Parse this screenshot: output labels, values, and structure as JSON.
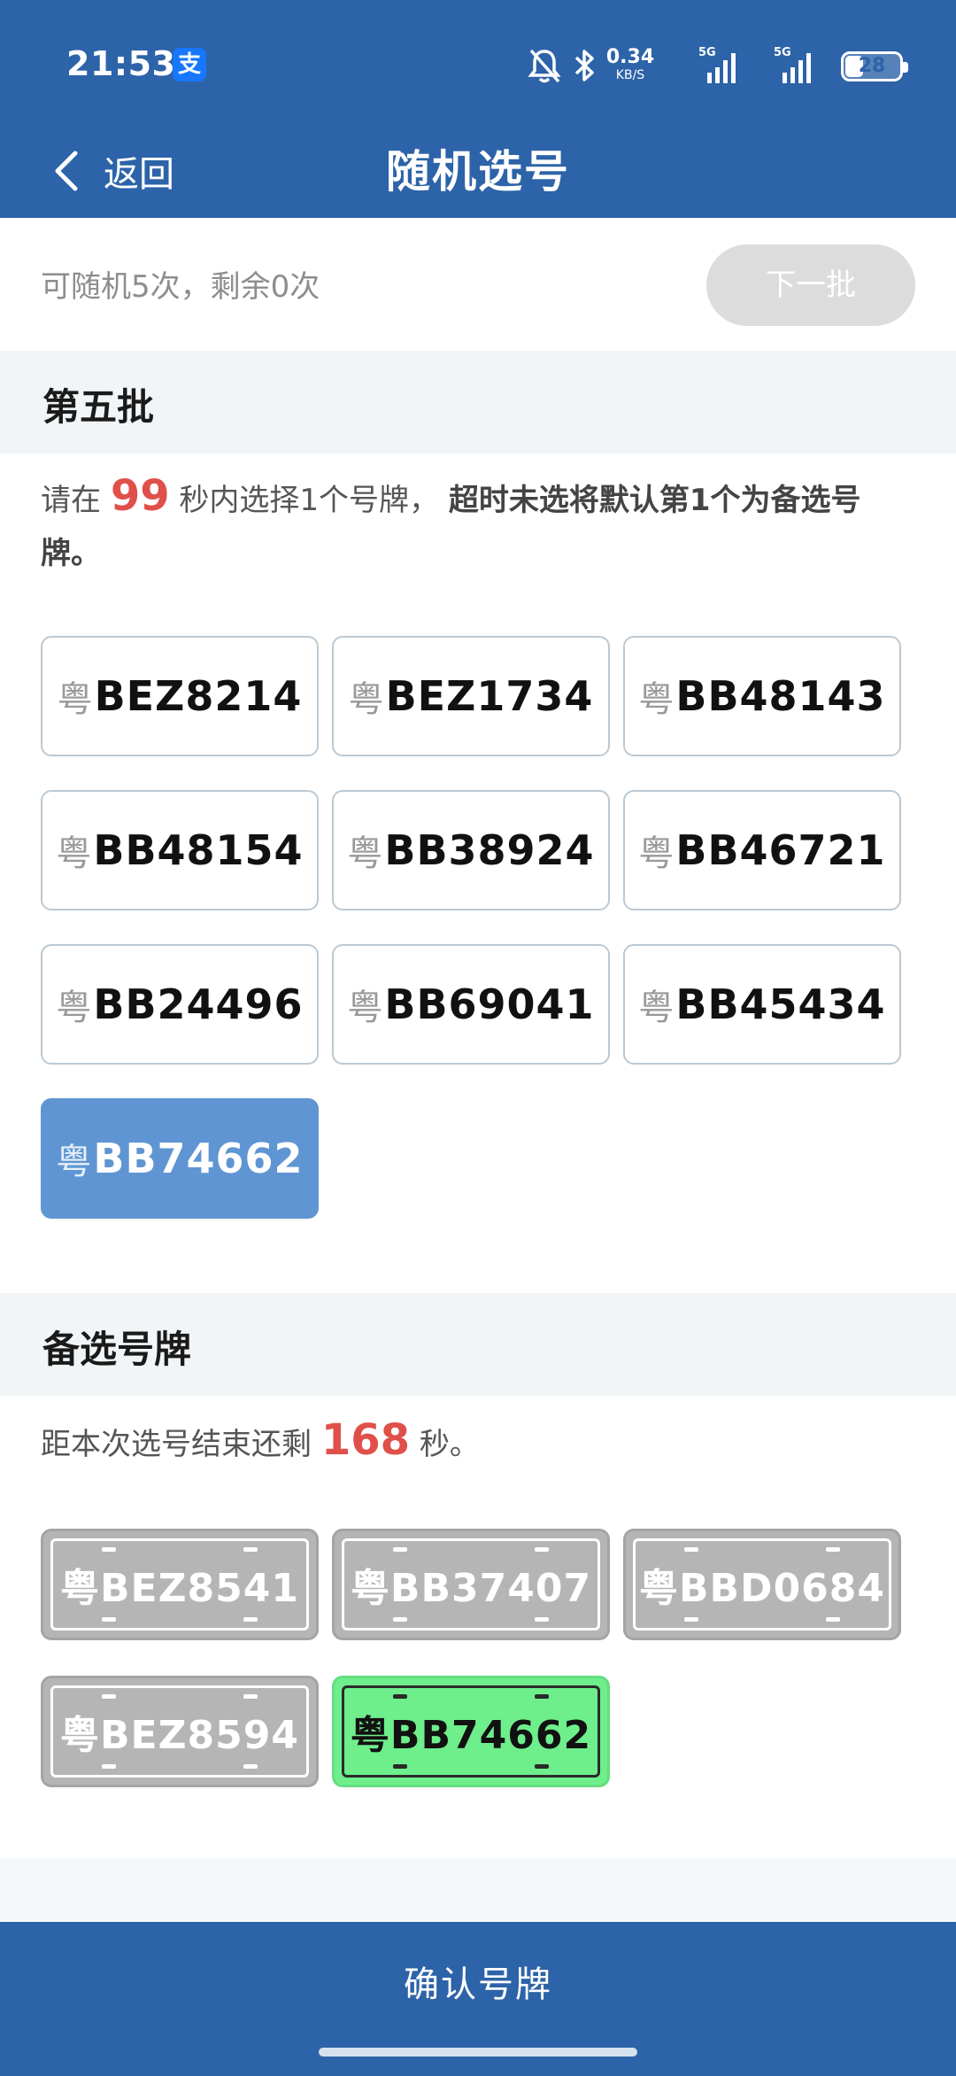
{
  "status_bar": {
    "time": "21:53",
    "alipay_glyph": "支",
    "speed_value": "0.34",
    "speed_unit": "KB/S",
    "network1": "5G",
    "network2": "5G",
    "battery": "28",
    "icons": [
      "bell-off-icon",
      "bluetooth-icon",
      "signal-icon",
      "battery-icon"
    ]
  },
  "nav": {
    "back_label": "返回",
    "title": "随机选号"
  },
  "random": {
    "info": "可随机5次，剩余0次",
    "next_batch_label": "下一批"
  },
  "batch": {
    "title": "第五批",
    "instruction_prefix": "请在",
    "seconds": "99",
    "instruction_middle": "秒内选择1个号牌，",
    "instruction_bold": "超时未选将默认第1个为备选号牌。",
    "plates": [
      {
        "province": "粤",
        "number": "BEZ8214"
      },
      {
        "province": "粤",
        "number": "BEZ1734"
      },
      {
        "province": "粤",
        "number": "BB48143"
      },
      {
        "province": "粤",
        "number": "BB48154"
      },
      {
        "province": "粤",
        "number": "BB38924"
      },
      {
        "province": "粤",
        "number": "BB46721"
      },
      {
        "province": "粤",
        "number": "BB24496"
      },
      {
        "province": "粤",
        "number": "BB69041"
      },
      {
        "province": "粤",
        "number": "BB45434"
      },
      {
        "province": "粤",
        "number": "BB74662"
      }
    ],
    "selected_index": 9
  },
  "alternates": {
    "title": "备选号牌",
    "countdown_prefix": "距本次选号结束还剩",
    "countdown_seconds": "168",
    "countdown_suffix": "秒。",
    "plates": [
      "粤BEZ8541",
      "粤BB37407",
      "粤BBD0684",
      "粤BEZ8594",
      "粤BB74662"
    ],
    "highlighted_index": 4
  },
  "confirm_label": "确认号牌",
  "colors": {
    "header_blue": "#2d63a8",
    "selected_plate": "#5f95d2",
    "alert_red": "#e0504a",
    "green_plate": "#6fee8c",
    "grey_plate": "#b5b5b5"
  }
}
